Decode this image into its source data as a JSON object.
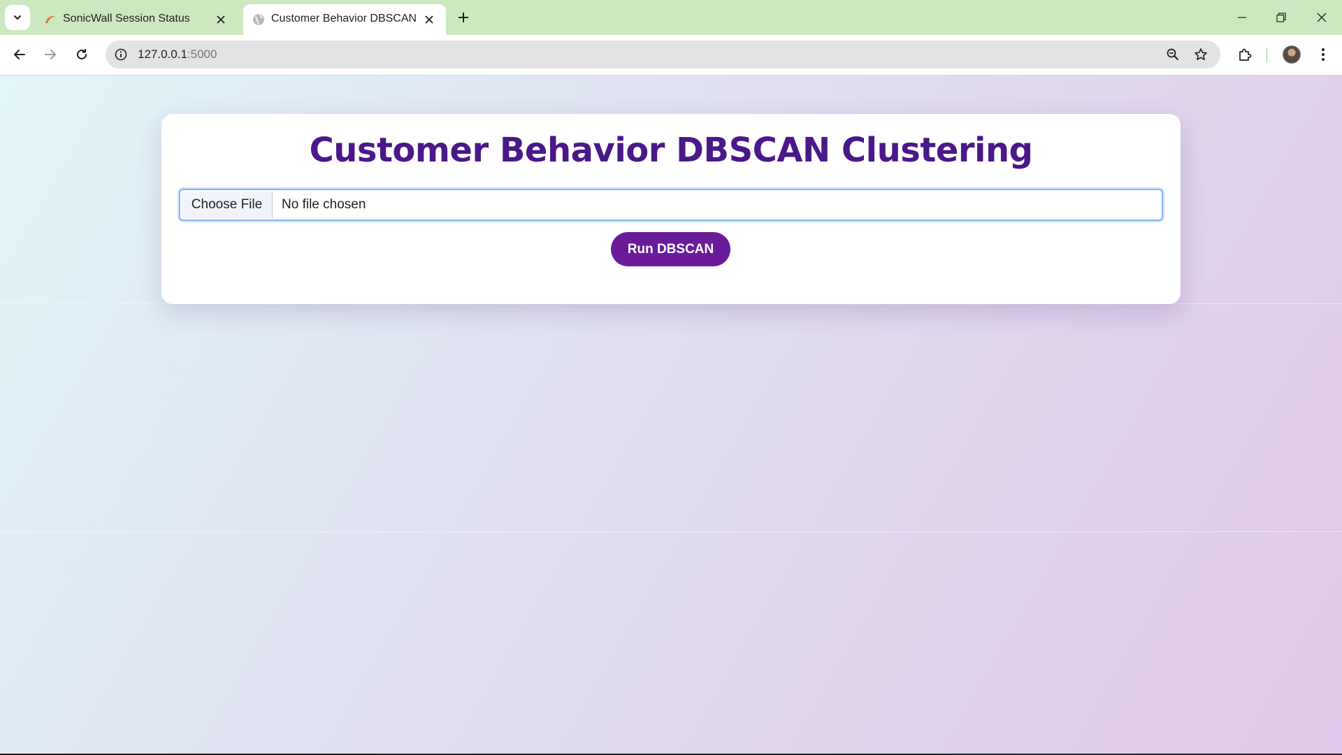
{
  "browser": {
    "tabs": [
      {
        "title": "SonicWall Session Status",
        "active": false
      },
      {
        "title": "Customer Behavior DBSCAN",
        "active": true
      }
    ],
    "address": {
      "host": "127.0.0.1",
      "port": ":5000"
    },
    "icons": {
      "tab_search": "chevron-down-icon",
      "new_tab": "plus-icon",
      "minimize": "minimize-icon",
      "restore": "restore-icon",
      "close": "close-icon",
      "back": "back-arrow-icon",
      "forward": "forward-arrow-icon",
      "reload": "reload-icon",
      "site_info": "info-icon",
      "zoom": "zoom-out-icon",
      "bookmark": "star-icon",
      "extensions": "puzzle-icon",
      "menu": "kebab-menu-icon"
    }
  },
  "page": {
    "title": "Customer Behavior DBSCAN Clustering",
    "file_input": {
      "button_label": "Choose File",
      "status": "No file chosen"
    },
    "run_button": "Run DBSCAN"
  },
  "colors": {
    "tabstrip": "#cce8c0",
    "title": "#4a1889",
    "run_button": "#6a1b9a",
    "focus_ring": "#8ab4f8"
  }
}
